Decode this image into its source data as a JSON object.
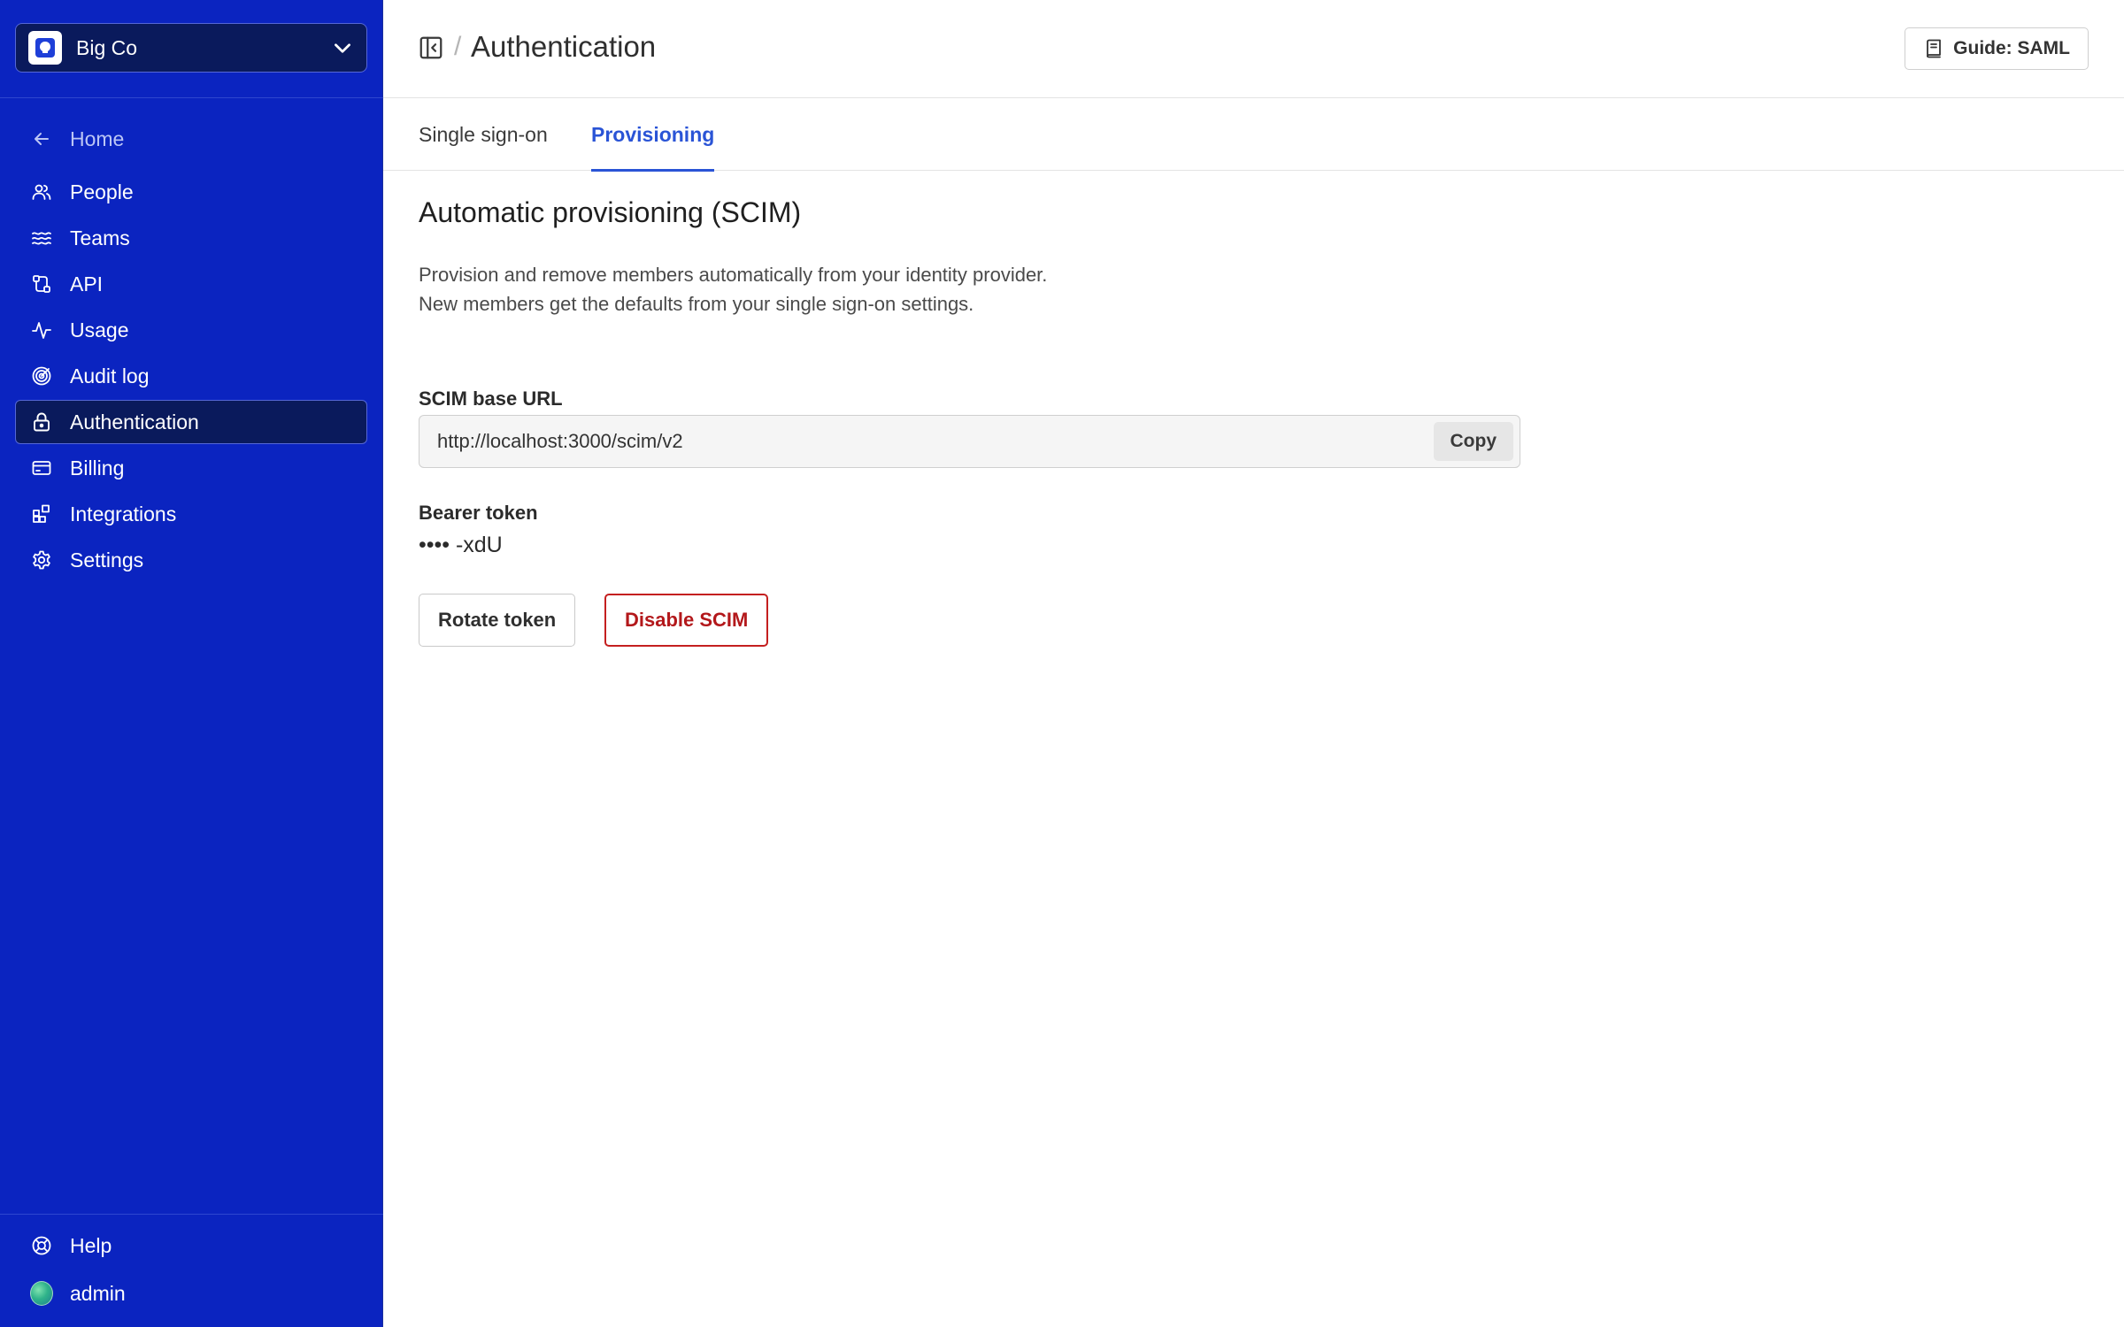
{
  "sidebar": {
    "org_name": "Big Co",
    "home_label": "Home",
    "items": [
      {
        "label": "People",
        "icon": "people-icon"
      },
      {
        "label": "Teams",
        "icon": "teams-icon"
      },
      {
        "label": "API",
        "icon": "api-icon"
      },
      {
        "label": "Usage",
        "icon": "usage-icon"
      },
      {
        "label": "Audit log",
        "icon": "audit-log-icon"
      },
      {
        "label": "Authentication",
        "icon": "lock-icon",
        "active": true
      },
      {
        "label": "Billing",
        "icon": "credit-card-icon"
      },
      {
        "label": "Integrations",
        "icon": "integrations-icon"
      },
      {
        "label": "Settings",
        "icon": "gear-icon"
      }
    ],
    "help_label": "Help",
    "user_name": "admin"
  },
  "header": {
    "title": "Authentication",
    "guide_label": "Guide: SAML"
  },
  "tabs": [
    {
      "label": "Single sign-on",
      "active": false
    },
    {
      "label": "Provisioning",
      "active": true
    }
  ],
  "scim": {
    "title": "Automatic provisioning (SCIM)",
    "description_line1": "Provision and remove members automatically from your identity provider.",
    "description_line2": "New members get the defaults from your single sign-on settings.",
    "base_url_label": "SCIM base URL",
    "base_url_value": "http://localhost:3000/scim/v2",
    "copy_label": "Copy",
    "token_label": "Bearer token",
    "token_value": "•••• -xdU",
    "rotate_label": "Rotate token",
    "disable_label": "Disable SCIM"
  },
  "colors": {
    "sidebar_bg": "#0b24c0",
    "sidebar_active_bg": "#0a1a5c",
    "accent": "#2a54d6",
    "danger": "#b3181b"
  }
}
